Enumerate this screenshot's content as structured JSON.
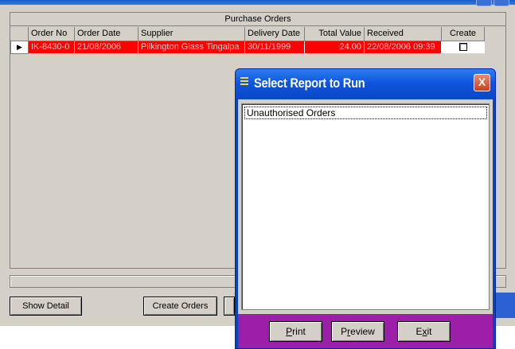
{
  "purchase_orders": {
    "caption": "Purchase Orders",
    "columns": [
      "Order No",
      "Order Date",
      "Supplier",
      "Delivery Date",
      "Total Value",
      "Received",
      "Create"
    ],
    "rows": [
      {
        "indicator": "▶",
        "order_no": "IK-8430-0",
        "order_date": "21/08/2006",
        "supplier": "Pilkington Glass Tingalpa",
        "delivery_date": "30/11/1999",
        "total_value": "24.00",
        "received": "22/08/2006 09:39",
        "create_checked": false
      }
    ]
  },
  "buttons": {
    "show_detail": "Show Detail",
    "create_orders": "Create Orders"
  },
  "dialog": {
    "title": "Select Report to Run",
    "close_glyph": "X",
    "reports": [
      "Unauthorised Orders"
    ],
    "buttons": {
      "print": {
        "mnemonic": "P",
        "rest": "rint"
      },
      "preview": {
        "pre": "P",
        "mnemonic": "r",
        "rest": "eview"
      },
      "exit": {
        "pre": "E",
        "mnemonic": "x",
        "rest": "it"
      }
    }
  },
  "colors": {
    "selected_row": "#ff0000",
    "selected_row_text": "#ffc8c8",
    "dialog_title": "#0a46c8",
    "dialog_footer": "#9d1ea8",
    "window_face": "#d4d0c8"
  }
}
